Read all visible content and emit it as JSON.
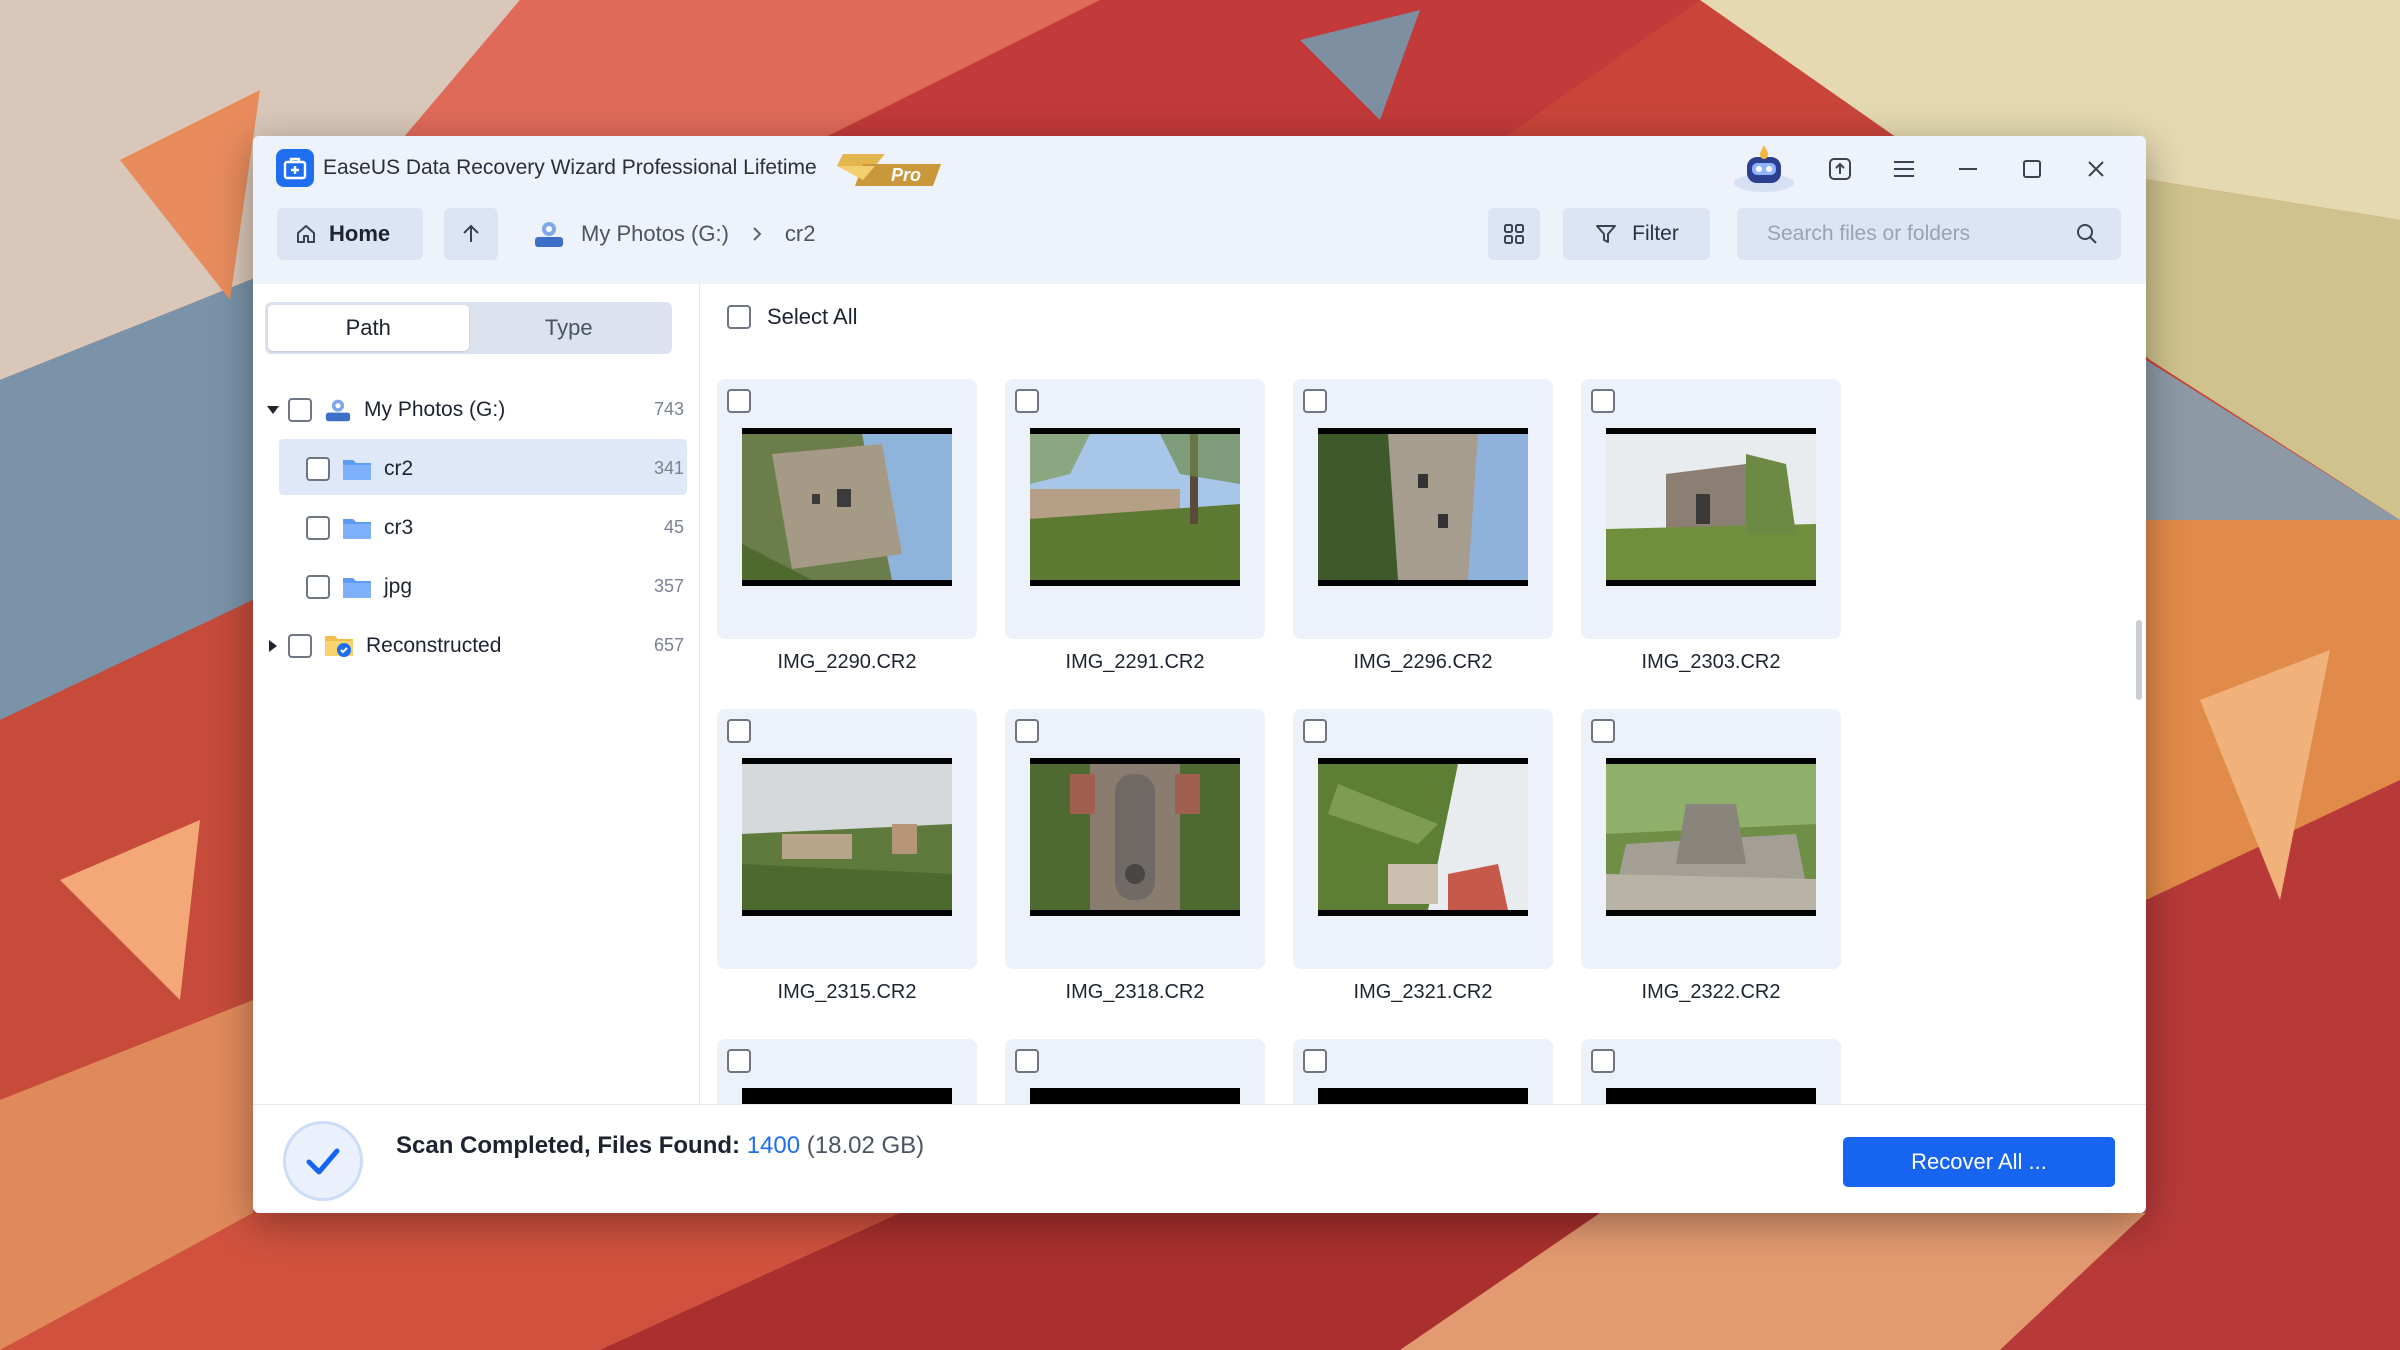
{
  "app": {
    "title": "EaseUS Data Recovery Wizard Professional Lifetime",
    "badge": "Pro",
    "accent": "#1764f0"
  },
  "toolbar": {
    "home_label": "Home",
    "breadcrumb": [
      "My Photos (G:)",
      "cr2"
    ],
    "filter_label": "Filter",
    "search_placeholder": "Search files or folders"
  },
  "sidebar": {
    "tabs": [
      {
        "label": "Path",
        "active": true
      },
      {
        "label": "Type",
        "active": false
      }
    ],
    "tree": [
      {
        "label": "My Photos (G:)",
        "count": "743",
        "level": 0,
        "expanded": true,
        "icon": "drive-icon"
      },
      {
        "label": "cr2",
        "count": "341",
        "level": 1,
        "selected": true,
        "icon": "folder-icon"
      },
      {
        "label": "cr3",
        "count": "45",
        "level": 1,
        "icon": "folder-icon"
      },
      {
        "label": "jpg",
        "count": "357",
        "level": 1,
        "icon": "folder-icon"
      },
      {
        "label": "Reconstructed",
        "count": "657",
        "level": 0,
        "expanded": false,
        "icon": "reconstructed-folder-icon"
      }
    ]
  },
  "main": {
    "select_all_label": "Select All",
    "files": [
      {
        "name": "IMG_2290.CR2"
      },
      {
        "name": "IMG_2291.CR2"
      },
      {
        "name": "IMG_2296.CR2"
      },
      {
        "name": "IMG_2303.CR2"
      },
      {
        "name": "IMG_2315.CR2"
      },
      {
        "name": "IMG_2318.CR2"
      },
      {
        "name": "IMG_2321.CR2"
      },
      {
        "name": "IMG_2322.CR2"
      }
    ]
  },
  "footer": {
    "status_label": "Scan Completed, Files Found:",
    "files_found": "1400",
    "total_size": "(18.02 GB)",
    "recover_label": "Recover All ..."
  }
}
